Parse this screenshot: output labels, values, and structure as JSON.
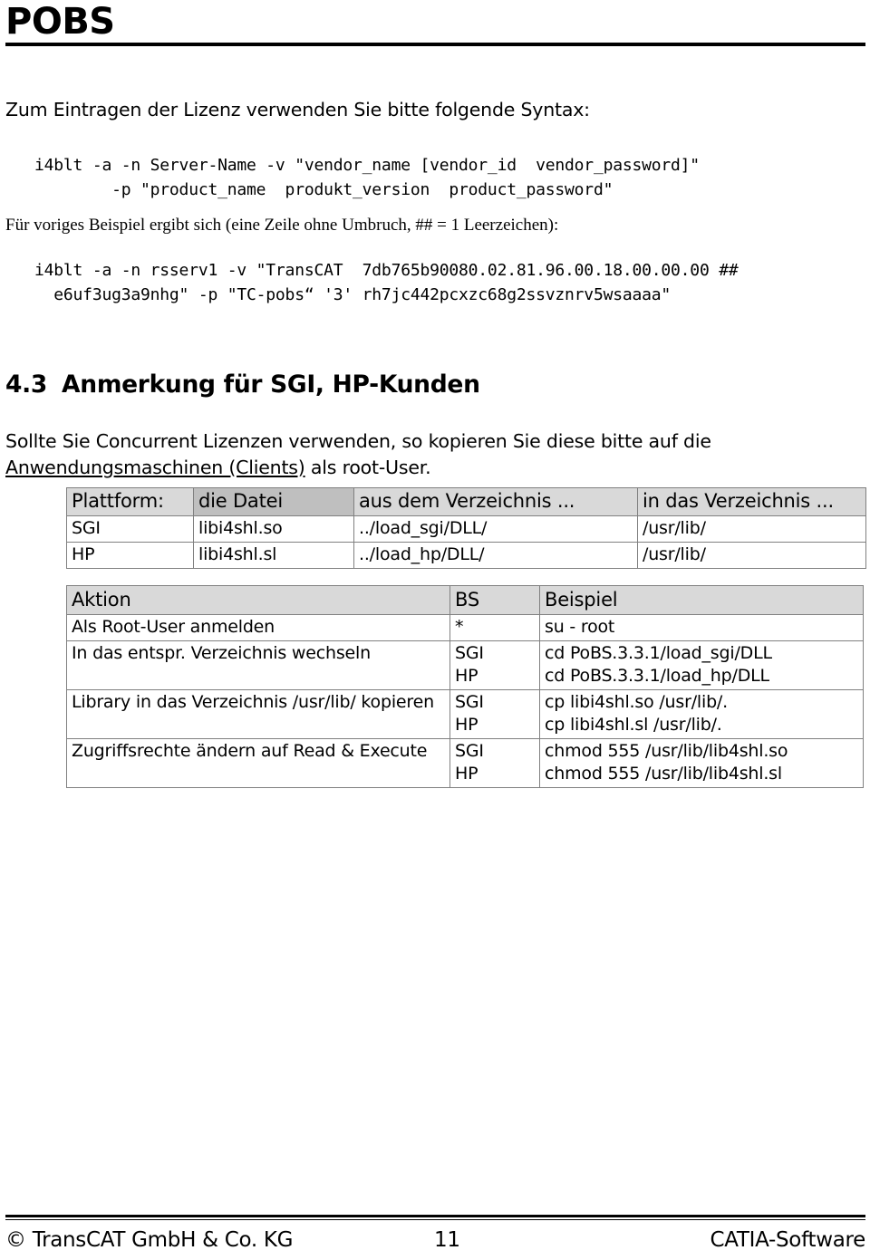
{
  "header": {
    "title": "POBS"
  },
  "intro": {
    "line": "Zum Eintragen der Lizenz verwenden Sie bitte folgende Syntax:"
  },
  "code_syntax": {
    "line1": "i4blt -a -n Server-Name -v \"vendor_name [vendor_id  vendor_password]\"",
    "line2": "        -p \"product_name  produkt_version  product_password\""
  },
  "serif_note": {
    "text": "Für voriges Beispiel ergibt sich (eine Zeile ohne Umbruch, ## = 1 Leerzeichen):"
  },
  "code_example": {
    "line1": "i4blt -a -n rsserv1 -v \"TransCAT  7db765b90080.02.81.96.00.18.00.00.00 ##",
    "line2": "  e6uf3ug3a9nhg\" -p \"TC-pobs“ '3' rh7jc442pcxzc68g2ssvznrv5wsaaaa\""
  },
  "section": {
    "number": "4.3",
    "title": "Anmerkung für SGI, HP-Kunden"
  },
  "paragraph": {
    "part1": "Sollte Sie Concurrent Lizenzen verwenden, so kopieren Sie diese bitte auf die ",
    "underlined": "Anwendungsmaschinen (Clients)",
    "part2": " als root-User."
  },
  "table_plattform": {
    "headers": {
      "c1": "Plattform:",
      "c2": "die Datei",
      "c3": "aus dem Verzeichnis ...",
      "c4": "in das Verzeichnis ..."
    },
    "rows": [
      {
        "c1": "SGI",
        "c2": "libi4shl.so",
        "c3": "../load_sgi/DLL/",
        "c4": "/usr/lib/"
      },
      {
        "c1": "HP",
        "c2": "libi4shl.sl",
        "c3": "../load_hp/DLL/",
        "c4": "/usr/lib/"
      }
    ]
  },
  "table_aktion": {
    "headers": {
      "c1": "Aktion",
      "c2": "BS",
      "c3": "Beispiel"
    },
    "rows": [
      {
        "aktion": "Als Root-User anmelden",
        "bs1": "*",
        "bs2": "",
        "bsp1": "su - root",
        "bsp2": ""
      },
      {
        "aktion": "In das entspr. Verzeichnis wechseln",
        "bs1": "SGI",
        "bs2": "HP",
        "bsp1": "cd PoBS.3.3.1/load_sgi/DLL",
        "bsp2": "cd PoBS.3.3.1/load_hp/DLL"
      },
      {
        "aktion": "Library in das Verzeichnis /usr/lib/ kopieren",
        "bs1": "SGI",
        "bs2": "HP",
        "bsp1": "cp libi4shl.so  /usr/lib/.",
        "bsp2": "cp libi4shl.sl  /usr/lib/."
      },
      {
        "aktion": "Zugriffsrechte ändern auf Read & Execute",
        "bs1": "SGI",
        "bs2": "HP",
        "bsp1": "chmod 555 /usr/lib/lib4shl.so",
        "bsp2": "chmod 555 /usr/lib/lib4shl.sl"
      }
    ]
  },
  "footer": {
    "left": "© TransCAT GmbH & Co. KG",
    "page_number": "11",
    "right": "CATIA-Software"
  },
  "colors": {
    "text": "#000000",
    "page_background": "#ffffff",
    "table_border": "#808080",
    "header_shade_light": "#d9d9d9",
    "header_shade_dark": "#bfbfbf"
  }
}
